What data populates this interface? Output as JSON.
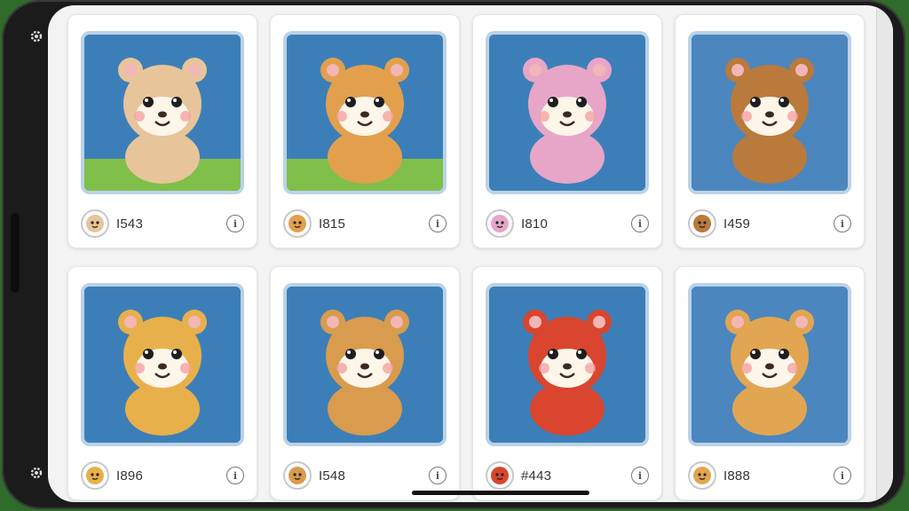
{
  "colors": {
    "bezel": "#1b1b1b",
    "screen": "#f3f3f4",
    "art_background": "#3c7fb8",
    "card": "#ffffff"
  },
  "edge_icons": [
    "gear-icon",
    "gear-icon"
  ],
  "cards": [
    {
      "name": "I543",
      "avatar": "bear-face-icon",
      "art": "tiger-cub-sitting",
      "accent": "#e8c49a"
    },
    {
      "name": "I815",
      "avatar": "lion-face-icon",
      "art": "lion-cub-sitting",
      "accent": "#e2a04c"
    },
    {
      "name": "I810",
      "avatar": "cat-face-icon",
      "art": "pink-cat-robot",
      "accent": "#e7a6c7"
    },
    {
      "name": "I459",
      "avatar": "dog-face-icon",
      "art": "dog-with-bandana",
      "accent": "#b97a3c"
    },
    {
      "name": "I896",
      "avatar": "tiger-face-icon",
      "art": "tiger-cub-waving",
      "accent": "#e8b04a"
    },
    {
      "name": "I548",
      "avatar": "lion-face-icon",
      "art": "lion-cub-green-collar",
      "accent": "#d99b4e"
    },
    {
      "name": "#443",
      "avatar": "chick-face-icon",
      "art": "red-robot-warrior",
      "accent": "#d9452e"
    },
    {
      "name": "I888",
      "avatar": "rooster-face-icon",
      "art": "bear-with-staff",
      "accent": "#e2a552"
    }
  ]
}
